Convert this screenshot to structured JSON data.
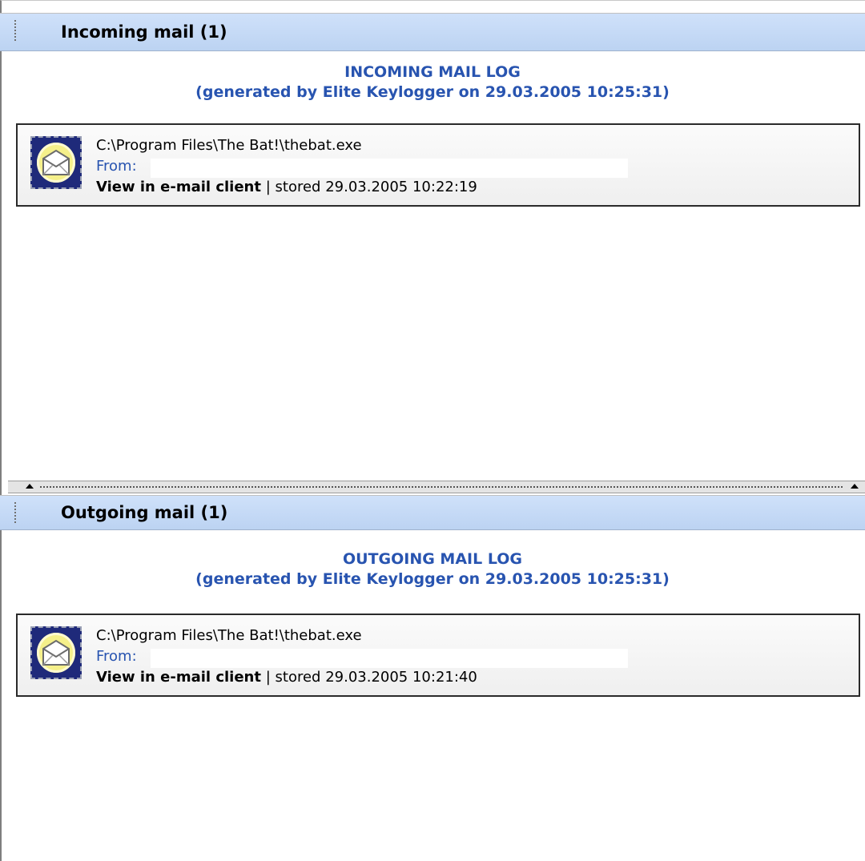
{
  "incoming": {
    "header_title": "Incoming mail (1)",
    "log_title": "INCOMING MAIL LOG",
    "log_subtitle": "(generated by Elite Keylogger on 29.03.2005 10:25:31)",
    "entries": [
      {
        "icon": "mail-stamp-icon",
        "path": "C:\\Program Files\\The Bat!\\thebat.exe",
        "from_label": "From:",
        "view_link": "View in e-mail client",
        "separator": "|",
        "stored": "stored 29.03.2005 10:22:19"
      }
    ]
  },
  "outgoing": {
    "header_title": "Outgoing mail (1)",
    "log_title": "OUTGOING MAIL LOG",
    "log_subtitle": "(generated by Elite Keylogger on 29.03.2005 10:25:31)",
    "entries": [
      {
        "icon": "mail-stamp-icon",
        "path": "C:\\Program Files\\The Bat!\\thebat.exe",
        "from_label": "From:",
        "view_link": "View in e-mail client",
        "separator": "|",
        "stored": "stored 29.03.2005 10:21:40"
      }
    ]
  },
  "colors": {
    "header_bg": "#cfe1fa",
    "log_title": "#2854b0",
    "from_label": "#2854b0",
    "stamp_frame": "#1f2a7a",
    "stamp_center": "#f5f08a"
  }
}
